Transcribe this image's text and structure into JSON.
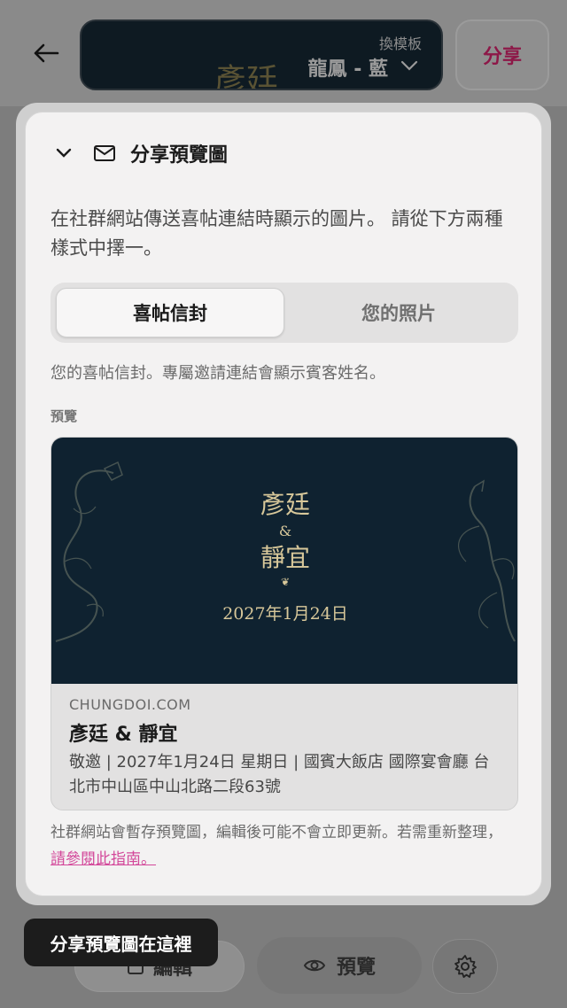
{
  "header": {
    "template_small_label": "換模板",
    "template_name": "龍鳳 - 藍",
    "template_ghost_text": "彥廷",
    "share_label": "分享"
  },
  "modal": {
    "title": "分享預覽圖",
    "description": "在社群網站傳送喜帖連結時顯示的圖片。 請從下方兩種樣式中擇一。",
    "segments": [
      {
        "label": "喜帖信封",
        "active": true
      },
      {
        "label": "您的照片",
        "active": false
      }
    ],
    "note": "您的喜帖信封。專屬邀請連結會顯示賓客姓名。",
    "preview_label": "預覽",
    "card": {
      "name1": "彥廷",
      "amp": "&",
      "name2": "靜宜",
      "ornament": "❦",
      "date": "2027年1月24日",
      "site": "CHUNGDOI.COM",
      "title": "彥廷 & 靜宜",
      "info": "敬邀 | 2027年1月24日 星期日 | 國賓大飯店 國際宴會廳 台北市中山區中山北路二段63號"
    },
    "footer_text": "社群網站會暫存預覽圖，編輯後可能不會立即更新。若需重新整理，",
    "footer_link": "請參閱此指南。"
  },
  "bottom": {
    "edit_label": "編輯",
    "preview_label": "預覽",
    "tooltip": "分享預覽圖在這裡"
  },
  "colors": {
    "accent_pink": "#d3489a",
    "card_navy": "#0f2230",
    "gold": "#d8c89a"
  }
}
